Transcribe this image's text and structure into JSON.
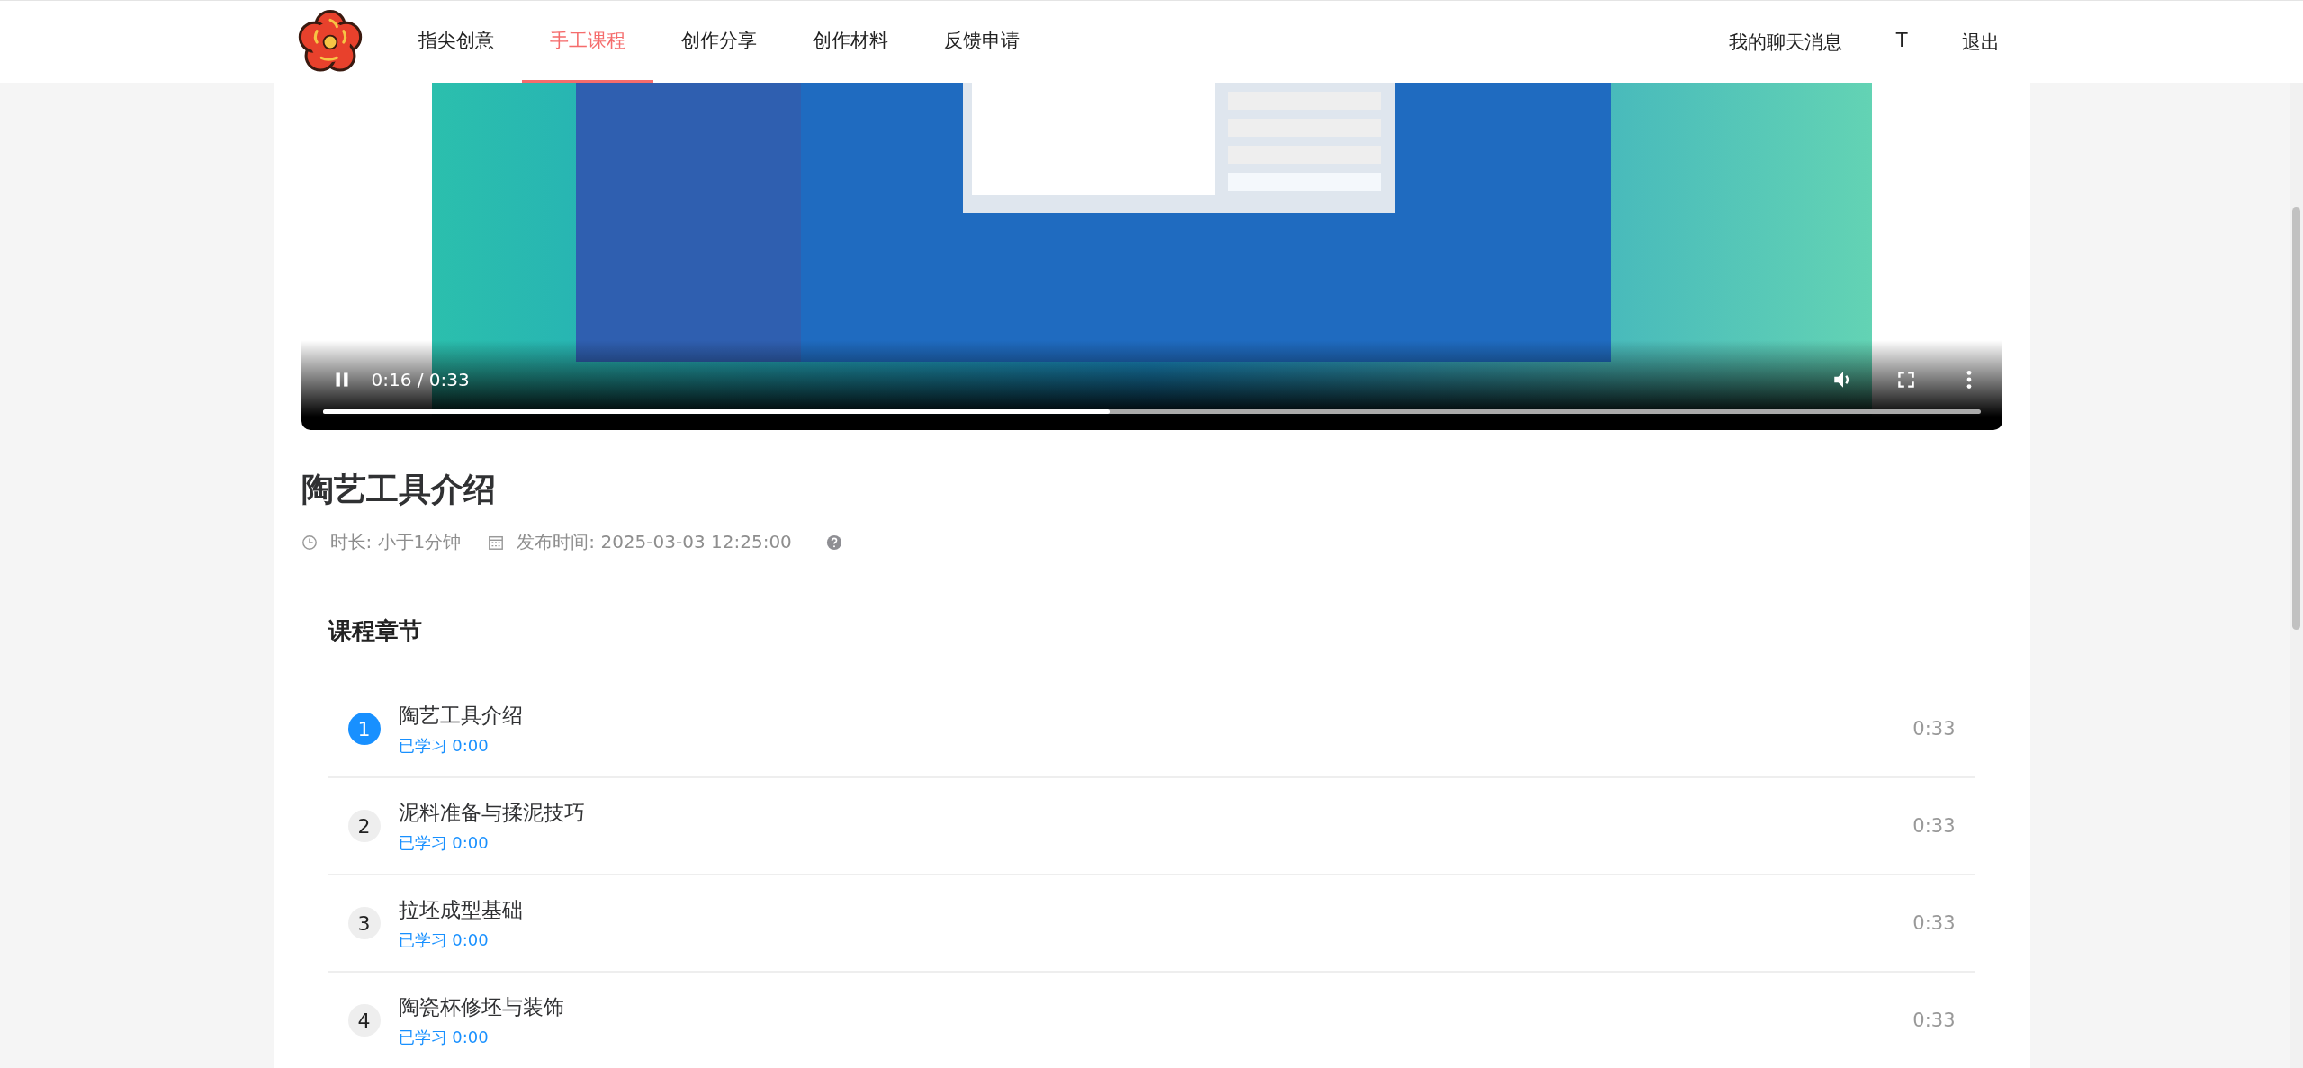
{
  "nav": {
    "items": [
      {
        "label": "指尖创意",
        "selected": false
      },
      {
        "label": "手工课程",
        "selected": true
      },
      {
        "label": "创作分享",
        "selected": false
      },
      {
        "label": "创作材料",
        "selected": false
      },
      {
        "label": "反馈申请",
        "selected": false
      }
    ],
    "right_links": [
      "我的聊天消息",
      "T",
      "退出"
    ]
  },
  "video": {
    "playing": true,
    "time": "0:16 / 0:33",
    "level": 0.475
  },
  "course": {
    "title": "陶艺工具介绍",
    "duration": "时长: 小于1分钟",
    "published": "发布时间: 2025-03-03 12:25:00"
  },
  "chapters": {
    "heading": "课程章节",
    "items": [
      {
        "number": "1",
        "title": "陶艺工具介绍",
        "progress": "已学习 0:00",
        "duration": "0:33",
        "selected": true
      },
      {
        "number": "2",
        "title": "泥料准备与揉泥技巧",
        "progress": "已学习 0:00",
        "duration": "0:33",
        "selected": false
      },
      {
        "number": "3",
        "title": "拉坯成型基础",
        "progress": "已学习 0:00",
        "duration": "0:33",
        "selected": false
      },
      {
        "number": "4",
        "title": "陶瓷杯修坯与装饰",
        "progress": "已学习 0:00",
        "duration": "0:33",
        "selected": false
      }
    ]
  }
}
